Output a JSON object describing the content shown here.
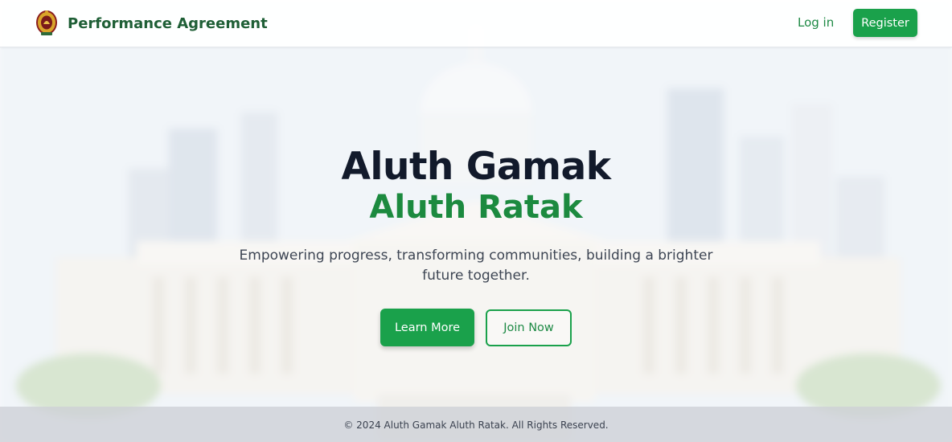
{
  "header": {
    "brand_title": "Performance Agreement",
    "emblem_icon": "national-emblem-icon",
    "login_label": "Log in",
    "register_label": "Register"
  },
  "hero": {
    "title_line1": "Aluth Gamak",
    "title_line2": "Aluth Ratak",
    "subtitle": "Empowering progress, transforming communities, building a brighter future together.",
    "learn_more_label": "Learn More",
    "join_now_label": "Join Now"
  },
  "footer": {
    "copyright": "© 2024 Aluth Gamak Aluth Ratak. All Rights Reserved."
  },
  "colors": {
    "brand_green": "#1aa14b",
    "title_dark": "#121a2b",
    "title_green": "#1c8a3f"
  }
}
